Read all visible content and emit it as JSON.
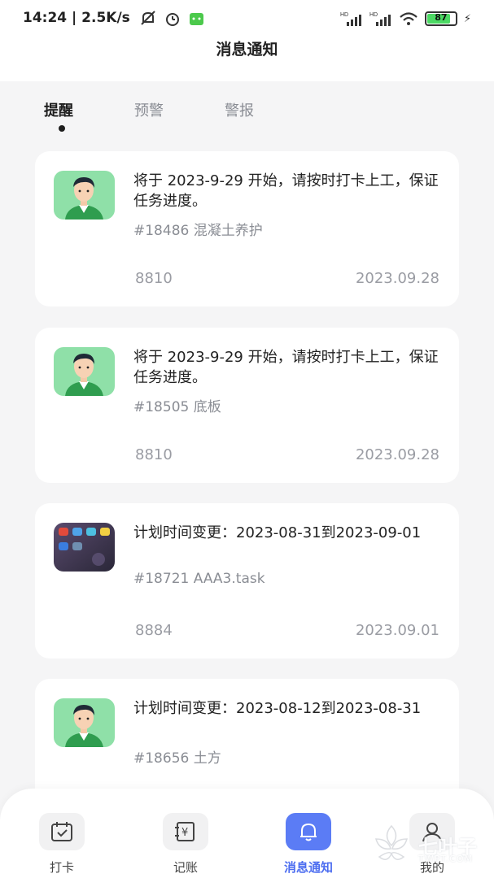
{
  "status_bar": {
    "time": "14:24",
    "speed": "2.5K/s",
    "battery": "87"
  },
  "header": {
    "title": "消息通知"
  },
  "tabs": [
    {
      "label": "提醒",
      "active": true
    },
    {
      "label": "预警",
      "active": false
    },
    {
      "label": "警报",
      "active": false
    }
  ],
  "messages": [
    {
      "text": "将于 2023-9-29 开始，请按时打卡上工，保证任务进度。",
      "sub": "#18486 混凝土养护",
      "id": "8810",
      "date": "2023.09.28",
      "avatar": "person-avatar"
    },
    {
      "text": "将于 2023-9-29 开始，请按时打卡上工，保证任务进度。",
      "sub": "#18505 底板",
      "id": "8810",
      "date": "2023.09.28",
      "avatar": "person-avatar"
    },
    {
      "text": "计划时间变更：2023-08-31到2023-09-01",
      "sub": "#18721 AAA3.task",
      "id": "8884",
      "date": "2023.09.01",
      "avatar": "phone-screenshot-avatar"
    },
    {
      "text": "计划时间变更：2023-08-12到2023-08-31",
      "sub": "#18656 土方",
      "id": "",
      "date": "",
      "avatar": "person-avatar"
    }
  ],
  "bottom_nav": [
    {
      "label": "打卡",
      "icon": "calendar-check-icon",
      "active": false
    },
    {
      "label": "记账",
      "icon": "ledger-yen-icon",
      "active": false
    },
    {
      "label": "消息通知",
      "icon": "bell-icon",
      "active": true
    },
    {
      "label": "我的",
      "icon": "user-icon",
      "active": false
    }
  ],
  "watermark": {
    "text": "七叶子",
    "sub": "TWPT.COM"
  },
  "colors": {
    "accent": "#5b7cf5",
    "avatar_bg": "#8fe0a8",
    "page_bg": "#f5f5f6"
  }
}
